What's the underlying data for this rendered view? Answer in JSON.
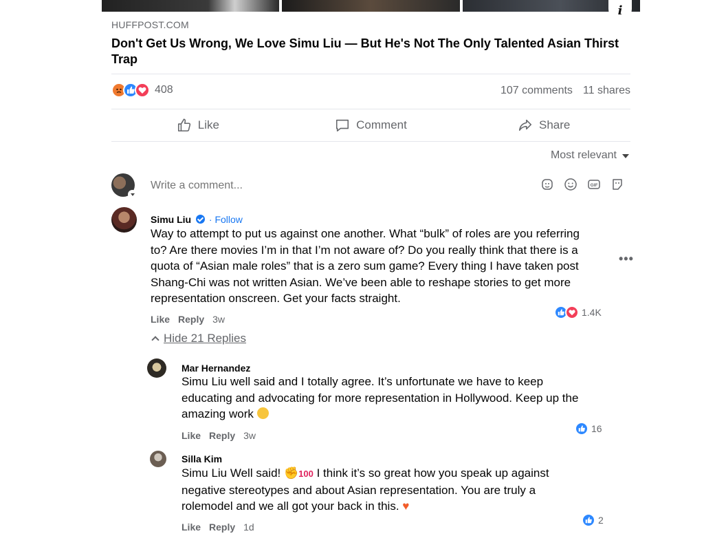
{
  "post": {
    "source": "HUFFPOST.COM",
    "headline": "Don't Get Us Wrong, We Love Simu Liu — But He's Not The Only Talented Asian Thirst Trap",
    "reaction_count": "408",
    "comments_count": "107 comments",
    "shares_count": "11 shares"
  },
  "actions": {
    "like": "Like",
    "comment": "Comment",
    "share": "Share"
  },
  "sort_label": "Most relevant",
  "composer": {
    "placeholder": "Write a comment..."
  },
  "comments": [
    {
      "author": "Simu Liu",
      "follow": "· Follow",
      "lines": [
        "Way to attempt to put us against one another. What “bulk” of roles are you referring",
        "to? Are there movies I’m in that I’m not aware of? Do you really think that there is a",
        "quota of “Asian male roles” that is a zero sum game? Every thing I have taken post",
        "Shang-Chi was not written Asian. We’ve been able to reshape stories to get more",
        "representation onscreen. Get your facts straight."
      ],
      "like": "Like",
      "reply": "Reply",
      "time": "3w",
      "reactions": "1.4K"
    }
  ],
  "hide_replies": "Hide 21 Replies",
  "replies": [
    {
      "author": "Mar Hernandez",
      "lines": [
        "Simu Liu well said and I totally agree. It’s unfortunate we have to keep",
        "educating and advocating for more representation in Hollywood. Keep up the",
        "amazing work"
      ],
      "like": "Like",
      "reply": "Reply",
      "time": "3w",
      "reactions": "16"
    },
    {
      "author": "Silla Kim",
      "lines": [
        "Simu Liu Well said!",
        "I think it’s so great how you speak up against",
        "negative stereotypes and about Asian representation. You are truly a",
        "rolemodel and we all got your back in this."
      ],
      "hundred": "100",
      "like": "Like",
      "reply": "Reply",
      "time": "1d",
      "reactions": "2"
    }
  ],
  "icons": {
    "info": "i",
    "more": "•••"
  },
  "colors": {
    "accent": "#1877f2",
    "secondary_text": "#65676b",
    "divider": "#e4e6eb",
    "like_blue": "#2d88ff",
    "love_red": "#f33e58",
    "angry_orange": "#f07a2f"
  }
}
